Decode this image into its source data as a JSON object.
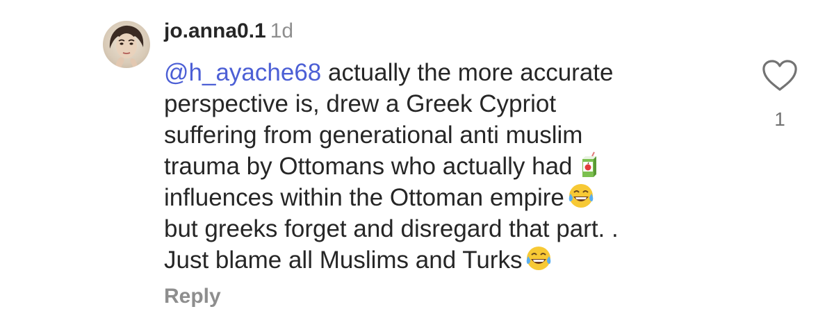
{
  "comment": {
    "username": "jo.anna0.1",
    "time": "1d",
    "mention": "@h_ayache68",
    "lines": [
      " actually the more accurate",
      "perspective is, drew a Greek Cypriot",
      "suffering from generational anti muslim",
      "trauma by Ottomans who actually had",
      "influences within the Ottoman empire",
      "but greeks forget and disregard that part. .",
      "Just blame all Muslims and Turks"
    ],
    "emojis": {
      "juice_box": "juice-box-icon",
      "laughing_1": "tears-of-joy-icon",
      "laughing_2": "tears-of-joy-icon"
    },
    "reply_label": "Reply",
    "like_count": "1",
    "like_icon": "heart-outline-icon"
  },
  "colors": {
    "text": "#262626",
    "muted": "#8e8e8e",
    "mention": "#4c5fd5"
  }
}
